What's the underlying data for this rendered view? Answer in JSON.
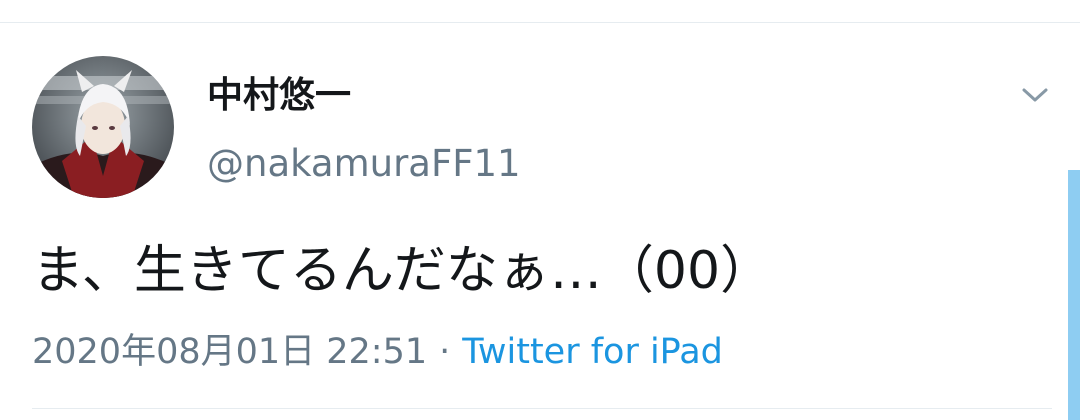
{
  "tweet": {
    "display_name": "中村悠一",
    "handle": "@nakamuraFF11",
    "text": "ま、生きてるんだなぁ…（00）",
    "timestamp": "2020年08月01日 22:51",
    "separator": "·",
    "source": "Twitter for iPad"
  },
  "icons": {
    "avatar": "user-avatar-image",
    "caret": "chevron-down-icon"
  },
  "colors": {
    "name": "#14171a",
    "secondary": "#657786",
    "link": "#1b95e0",
    "divider": "#e6ecf0",
    "scrollbar": "#8ecdf2"
  }
}
